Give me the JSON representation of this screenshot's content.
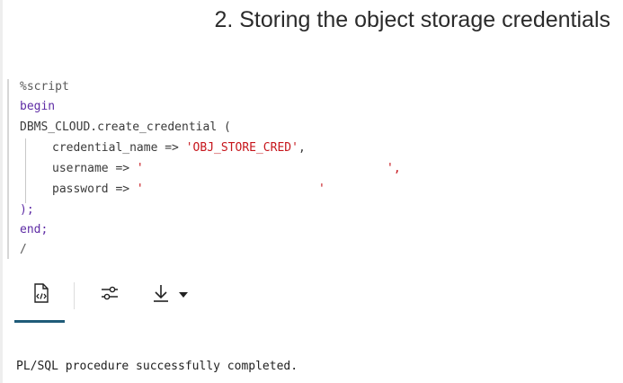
{
  "heading": "2. Storing the object storage credentials",
  "code": {
    "line1": "%script",
    "line2": "begin",
    "line3_call": "DBMS_CLOUD.create_credential (",
    "cred_name_param": "credential_name =>",
    "cred_name_value": "'OBJ_STORE_CRED'",
    "cred_name_comma": ",",
    "username_param": "username =>",
    "username_open_quote": "'",
    "username_close": "',",
    "password_param": "password =>",
    "password_open_quote": "'",
    "password_close_quote": "'",
    "close_paren": ");",
    "end": "end;",
    "slash": "/"
  },
  "toolbar": {
    "icons": [
      "code-output-icon",
      "settings-sliders-icon",
      "download-icon",
      "caret-down-icon"
    ]
  },
  "result": {
    "message": "PL/SQL procedure successfully completed."
  }
}
